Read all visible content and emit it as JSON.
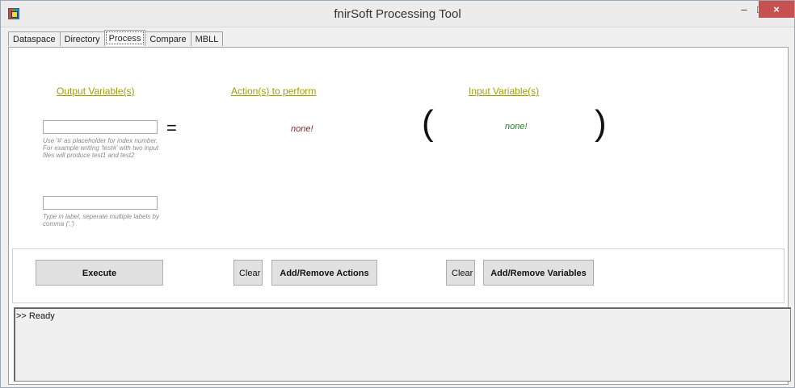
{
  "window": {
    "title": "fnirSoft Processing Tool",
    "minimize": "–",
    "maximize": "□",
    "close": "×",
    "icon": "app-grid-icon"
  },
  "tabs": [
    "Dataspace",
    "Directory",
    "Process",
    "Compare",
    "MBLL"
  ],
  "active_tab": "Process",
  "headings": {
    "output": "Output Variable(s)",
    "actions": "Action(s) to perform",
    "input": "Input Variable(s)"
  },
  "output_field": {
    "value": "",
    "hint": "Use '#' as placeholder for index number. For example writing 'test#' with two input files will produce test1 and test2"
  },
  "label_field": {
    "value": "",
    "hint": "Type in label, seperate multiple labels by comma (',')"
  },
  "equals": "=",
  "actions_value": "none!",
  "inputs_value": "none!",
  "paren_left": "(",
  "paren_right": ")",
  "buttons": {
    "execute": "Execute",
    "clear_actions": "Clear",
    "add_remove_actions": "Add/Remove Actions",
    "clear_variables": "Clear",
    "add_remove_variables": "Add/Remove Variables"
  },
  "console": {
    "text": ">> Ready"
  }
}
